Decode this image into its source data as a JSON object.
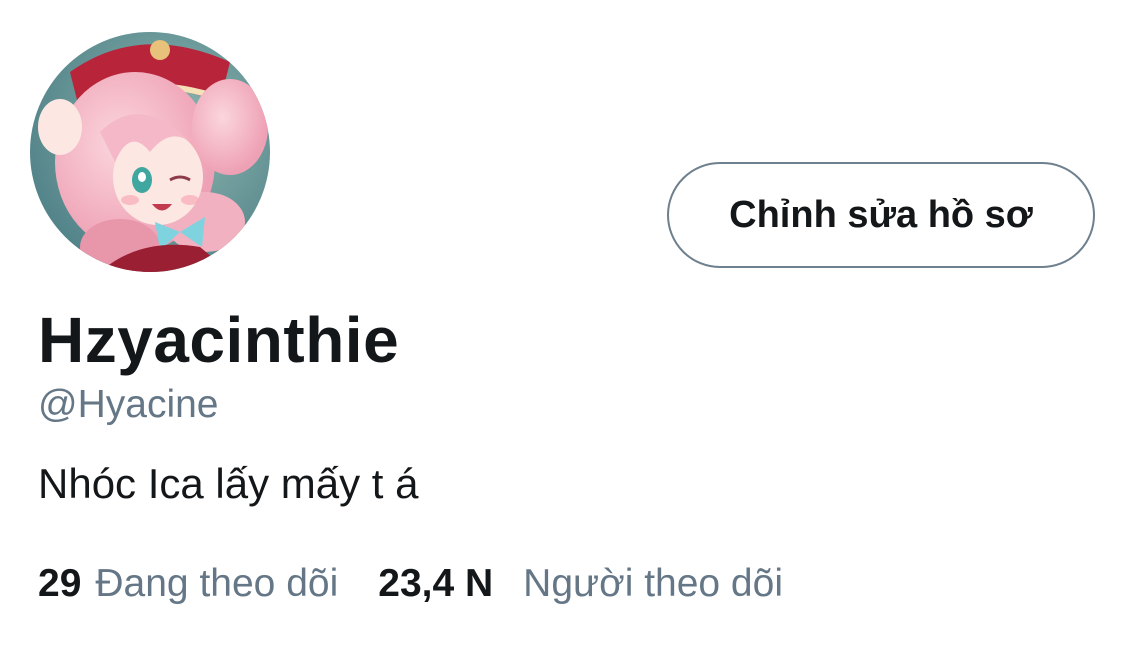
{
  "profile": {
    "display_name": "Hzyacinthie",
    "handle": "@Hyacine",
    "bio": "Nhóc Ica lấy mấy t á",
    "edit_button_label": "Chỉnh sửa hồ sơ",
    "avatar_alt": "avatar"
  },
  "stats": {
    "following_count": "29",
    "following_label": "Đang theo dõi",
    "followers_count": "23,4 N",
    "followers_label": "Người theo dõi"
  },
  "colors": {
    "text_primary": "#14171a",
    "text_secondary": "#657786",
    "button_border": "#6e7f8d"
  }
}
